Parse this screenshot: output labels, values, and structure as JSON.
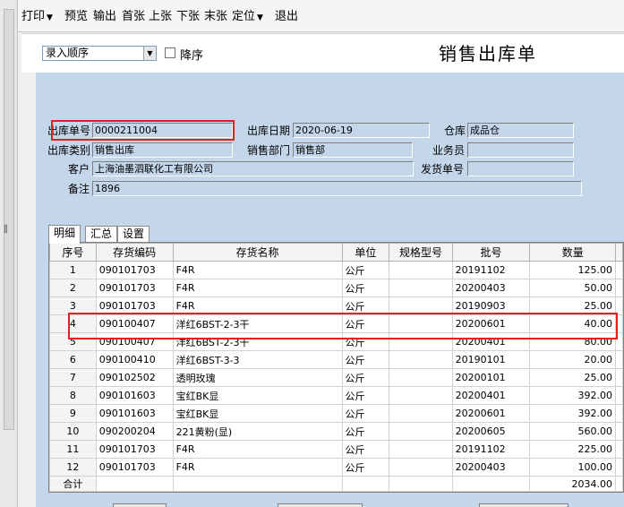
{
  "menu": [
    {
      "label": "打印",
      "has_dropdown": true
    },
    {
      "label": "预览"
    },
    {
      "label": "输出"
    },
    {
      "label": "首张"
    },
    {
      "label": "上张"
    },
    {
      "label": "下张"
    },
    {
      "label": "末张"
    },
    {
      "label": "定位",
      "has_dropdown": true
    },
    {
      "label": "退出"
    }
  ],
  "menu_dropdown_glyph": "▼",
  "toolbar": {
    "order_value": "录入顺序",
    "desc_label": "降序",
    "desc_checked": false
  },
  "form": {
    "title": "销售出库单",
    "fields": {
      "out_no": {
        "label": "出库单号",
        "value": "0000211004"
      },
      "out_date": {
        "label": "出库日期",
        "value": "2020-06-19"
      },
      "warehouse": {
        "label": "仓库",
        "value": "成品仓"
      },
      "out_type": {
        "label": "出库类别",
        "value": "销售出库"
      },
      "sales_dept": {
        "label": "销售部门",
        "value": "销售部"
      },
      "salesman": {
        "label": "业务员",
        "value": ""
      },
      "customer": {
        "label": "客户",
        "value": "上海油墨泗联化工有限公司"
      },
      "ship_no": {
        "label": "发货单号",
        "value": ""
      },
      "remark": {
        "label": "备注",
        "value": "1896"
      }
    }
  },
  "tabs": [
    "明细",
    "汇总",
    "设置"
  ],
  "table": {
    "columns": [
      "序号",
      "存货编码",
      "存货名称",
      "单位",
      "规格型号",
      "批号",
      "数量"
    ],
    "rows": [
      [
        "1",
        "090101703",
        "F4R",
        "公斤",
        "",
        "20191102",
        "125.00"
      ],
      [
        "2",
        "090101703",
        "F4R",
        "公斤",
        "",
        "20200403",
        "50.00"
      ],
      [
        "3",
        "090101703",
        "F4R",
        "公斤",
        "",
        "20190903",
        "25.00"
      ],
      [
        "4",
        "090100407",
        "洋红6BST-2-3干",
        "公斤",
        "",
        "20200601",
        "40.00"
      ],
      [
        "5",
        "090100407",
        "洋红6BST-2-3干",
        "公斤",
        "",
        "20200401",
        "80.00"
      ],
      [
        "6",
        "090100410",
        "洋红6BST-3-3",
        "公斤",
        "",
        "20190101",
        "20.00"
      ],
      [
        "7",
        "090102502",
        "透明玫瑰",
        "公斤",
        "",
        "20200101",
        "25.00"
      ],
      [
        "8",
        "090101603",
        "宝红BK显",
        "公斤",
        "",
        "20200401",
        "392.00"
      ],
      [
        "9",
        "090101603",
        "宝红BK显",
        "公斤",
        "",
        "20200601",
        "392.00"
      ],
      [
        "10",
        "090200204",
        "221黄粉(显)",
        "公斤",
        "",
        "20200605",
        "560.00"
      ],
      [
        "11",
        "090101703",
        "F4R",
        "公斤",
        "",
        "20191102",
        "225.00"
      ],
      [
        "12",
        "090101703",
        "F4R",
        "公斤",
        "",
        "20200403",
        "100.00"
      ]
    ],
    "total": {
      "label": "合计",
      "qty": "2034.00"
    },
    "highlighted_row": 4
  },
  "colors": {
    "form_bg": "#c4d6ea",
    "highlight": "#e02020"
  }
}
